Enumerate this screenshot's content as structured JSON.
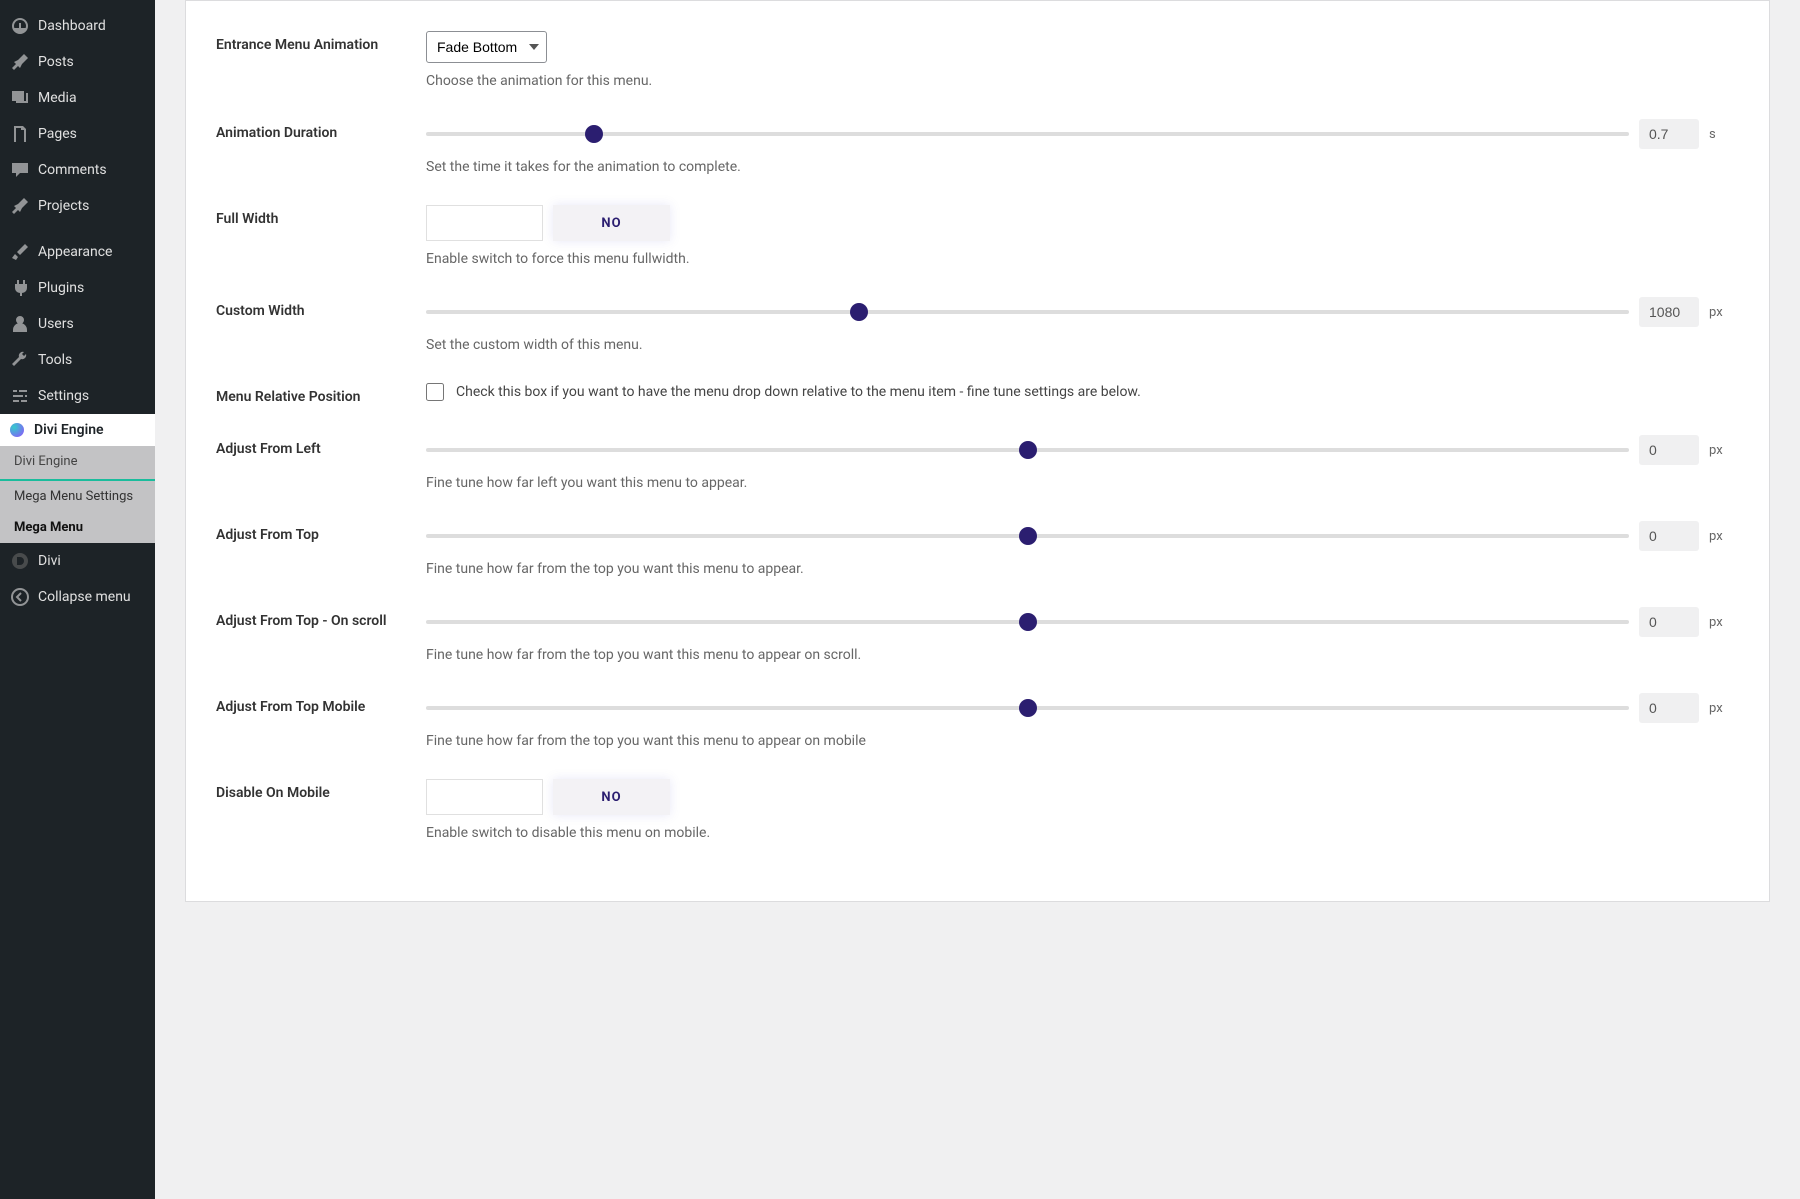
{
  "sidebar": {
    "items": [
      {
        "label": "Dashboard"
      },
      {
        "label": "Posts"
      },
      {
        "label": "Media"
      },
      {
        "label": "Pages"
      },
      {
        "label": "Comments"
      },
      {
        "label": "Projects"
      },
      {
        "label": "Appearance"
      },
      {
        "label": "Plugins"
      },
      {
        "label": "Users"
      },
      {
        "label": "Tools"
      },
      {
        "label": "Settings"
      }
    ],
    "active": {
      "label": "Divi Engine"
    },
    "submenu": [
      {
        "label": "Divi Engine"
      },
      {
        "label": "Mega Menu Settings"
      },
      {
        "label": "Mega Menu"
      }
    ],
    "divi": {
      "label": "Divi"
    },
    "collapse": {
      "label": "Collapse menu"
    }
  },
  "settings": {
    "entrance_animation": {
      "label": "Entrance Menu Animation",
      "value": "Fade Bottom",
      "help": "Choose the animation for this menu."
    },
    "animation_duration": {
      "label": "Animation Duration",
      "value": "0.7",
      "unit": "s",
      "percent": 14,
      "help": "Set the time it takes for the animation to complete."
    },
    "full_width": {
      "label": "Full Width",
      "value_no": "NO",
      "help": "Enable switch to force this menu fullwidth."
    },
    "custom_width": {
      "label": "Custom Width",
      "value": "1080",
      "unit": "px",
      "percent": 36,
      "help": "Set the custom width of this menu."
    },
    "menu_relative": {
      "label": "Menu Relative Position",
      "text": "Check this box if you want to have the menu drop down relative to the menu item - fine tune settings are below."
    },
    "adjust_left": {
      "label": "Adjust From Left",
      "value": "0",
      "unit": "px",
      "percent": 50,
      "help": "Fine tune how far left you want this menu to appear."
    },
    "adjust_top": {
      "label": "Adjust From Top",
      "value": "0",
      "unit": "px",
      "percent": 50,
      "help": "Fine tune how far from the top you want this menu to appear."
    },
    "adjust_top_scroll": {
      "label": "Adjust From Top - On scroll",
      "value": "0",
      "unit": "px",
      "percent": 50,
      "help": "Fine tune how far from the top you want this menu to appear on scroll."
    },
    "adjust_top_mobile": {
      "label": "Adjust From Top Mobile",
      "value": "0",
      "unit": "px",
      "percent": 50,
      "help": "Fine tune how far from the top you want this menu to appear on mobile"
    },
    "disable_mobile": {
      "label": "Disable On Mobile",
      "value_no": "NO",
      "help": "Enable switch to disable this menu on mobile."
    }
  }
}
